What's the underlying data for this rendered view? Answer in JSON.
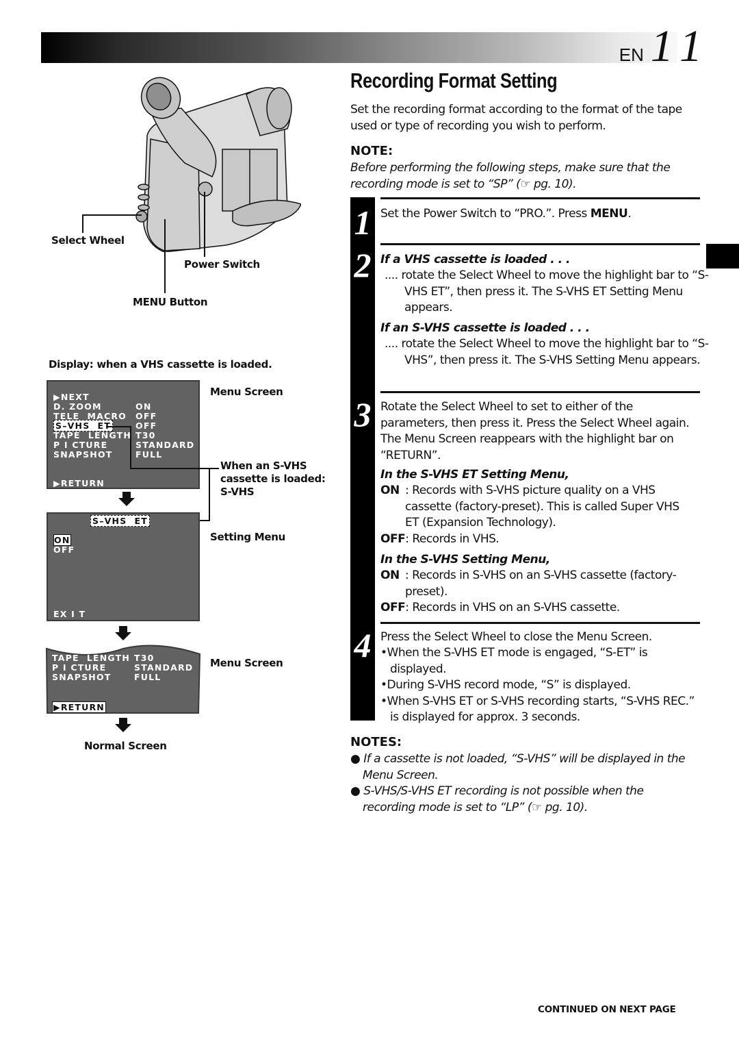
{
  "header": {
    "lang": "EN",
    "page_number": "11",
    "title": "Recording Format Setting"
  },
  "camera_figure": {
    "icon": "camcorder-illustration",
    "labels": {
      "select_wheel": "Select Wheel",
      "power_switch": "Power Switch",
      "menu_button": "MENU Button"
    }
  },
  "display_caption": "Display: when a VHS cassette is loaded.",
  "menu_screen_1": {
    "side_label": "Menu Screen",
    "rows": [
      {
        "item": "▶NEXT",
        "value": ""
      },
      {
        "item": "D. ZOOM",
        "value": "ON"
      },
      {
        "item": "TELE  MACRO",
        "value": "OFF"
      },
      {
        "item": "S–VHS  ET",
        "value": "OFF",
        "highlighted": true
      },
      {
        "item": "TAPE  LENGTH",
        "value": "T30"
      },
      {
        "item": "P I CTURE",
        "value": "STANDARD"
      },
      {
        "item": "SNAPSHOT",
        "value": "FULL"
      }
    ],
    "return_label": "▶RETURN",
    "callout": [
      "When an S-VHS",
      "cassette is loaded:",
      "S-VHS"
    ]
  },
  "setting_menu": {
    "side_label": "Setting Menu",
    "title": "S–VHS  ET",
    "options": [
      "ON",
      "OFF"
    ],
    "selected": "ON",
    "exit_label": "EX I T"
  },
  "menu_screen_2": {
    "side_label": "Menu Screen",
    "rows": [
      {
        "item": "TAPE  LENGTH",
        "value": "T30"
      },
      {
        "item": "P I CTURE",
        "value": "STANDARD"
      },
      {
        "item": "SNAPSHOT",
        "value": "FULL"
      }
    ],
    "return_label": "▶RETURN"
  },
  "normal_screen_label": "Normal Screen",
  "intro": "Set the recording format according to the format of the tape used or type of recording you wish to perform.",
  "note": {
    "heading": "NOTE:",
    "text": "Before performing the following steps, make sure that the recording mode is set to “SP” (☞ pg. 10)."
  },
  "steps": [
    {
      "number": "1",
      "text_pre": "Set the Power Switch to “PRO.”. Press ",
      "text_bold": "MENU",
      "text_post": "."
    },
    {
      "number": "2",
      "sub_a_heading": "If a VHS cassette is loaded . . .",
      "sub_a_text": ".... rotate the Select Wheel to move the highlight bar to “S-VHS ET”, then press it. The S-VHS ET Setting Menu appears.",
      "sub_b_heading": "If an S-VHS cassette is loaded . . .",
      "sub_b_text": ".... rotate the Select Wheel to move the highlight bar to “S-VHS”, then press it. The S-VHS Setting Menu appears."
    },
    {
      "number": "3",
      "text": "Rotate the Select Wheel to set to either of the parameters, then press it. Press the Select Wheel again. The Menu Screen reappears with the highlight bar on “RETURN”.",
      "et_heading": "In the S-VHS ET Setting Menu,",
      "et_on_label": "ON",
      "et_on_text": "Records with S-VHS picture quality on a VHS cassette (factory-preset). This is called Super VHS ET (Expansion Technology).",
      "et_off_label": "OFF",
      "et_off_text": "Records in VHS.",
      "svhs_heading": "In the S-VHS Setting Menu,",
      "svhs_on_label": "ON",
      "svhs_on_text": "Records in S-VHS on an S-VHS cassette (factory-preset).",
      "svhs_off_label": "OFF",
      "svhs_off_text": "Records in VHS on an S-VHS cassette."
    },
    {
      "number": "4",
      "text": "Press the Select Wheel to close the Menu Screen.",
      "bullets": [
        "When the S-VHS ET mode is engaged, “S-ET” is displayed.",
        "During S-VHS record mode, “S” is displayed.",
        "When S-VHS ET or S-VHS recording starts, “S-VHS REC.” is displayed for approx. 3 seconds."
      ]
    }
  ],
  "notes": {
    "heading": "NOTES:",
    "items": [
      "If a cassette is not loaded, “S-VHS” will be displayed in the Menu Screen.",
      "S-VHS/S-VHS ET recording is not possible when the recording mode is set to “LP” (☞ pg. 10)."
    ]
  },
  "footer": "CONTINUED ON NEXT PAGE"
}
